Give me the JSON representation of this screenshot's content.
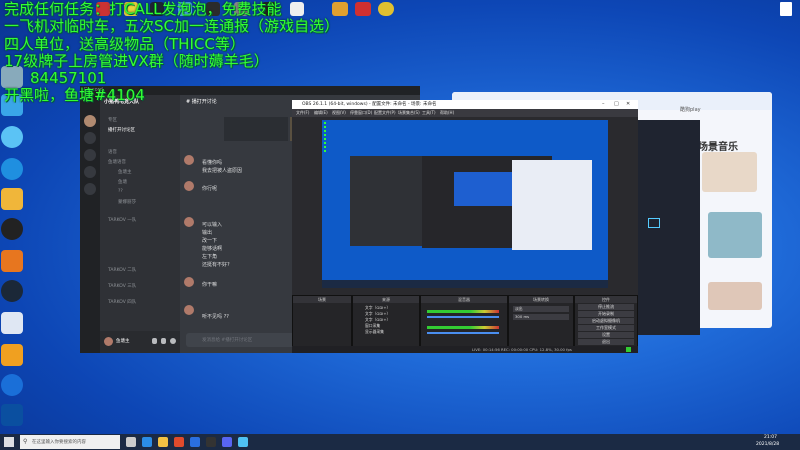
{
  "overlay": {
    "line1": "完成任何任务：打CALL发泡泡，免费技能",
    "line2": "一飞机对临时车，五次SC加一连通报（游戏自选）",
    "line3": "四人单位，送高级物品（THICC等）",
    "line4": "17级牌子上房管进VX群（随时薅羊毛）",
    "line5": "84457101",
    "line6": "开黑啦，鱼塘#4104"
  },
  "desktop_icons": [
    {
      "name": "recycle-bin-icon",
      "label": ""
    },
    {
      "name": "computer-icon",
      "label": ""
    },
    {
      "name": "cloud-icon",
      "label": ""
    },
    {
      "name": "ie-icon",
      "label": ""
    },
    {
      "name": "app-icon",
      "label": ""
    },
    {
      "name": "qq-icon",
      "label": ""
    },
    {
      "name": "app-icon",
      "label": ""
    },
    {
      "name": "steam-icon",
      "label": ""
    },
    {
      "name": "chat-icon",
      "label": ""
    },
    {
      "name": "help-icon",
      "label": ""
    },
    {
      "name": "k-icon",
      "label": ""
    },
    {
      "name": "settings-icon",
      "label": ""
    }
  ],
  "discord": {
    "title": "Discord",
    "server_name": "小猪鸭电竞大队",
    "channels": [
      {
        "label": "专区"
      },
      {
        "label": "专区"
      },
      {
        "label": "播打开讨论区"
      },
      {
        "label": "语音"
      },
      {
        "label": "鱼塘语音"
      },
      {
        "label": "TARKOV 一队"
      },
      {
        "label": "TARKOV 二队"
      },
      {
        "label": "TARKOV 三队"
      },
      {
        "label": "TARKOV 四队"
      }
    ],
    "voice_members": [
      "鱼塘主",
      "鱼塘",
      "??",
      "蒙娜丽莎"
    ],
    "chat_header": "# 播打开讨论",
    "messages": [
      "看懂你吗",
      "我去把被人盗原因",
      "你行呢",
      "可以输入",
      "输出",
      "改一下",
      "能够话啊",
      "左下角",
      "还挺有不好?",
      "你干嘛",
      "听不见吗 ??"
    ],
    "input_placeholder": "发消息给 #播打开讨论区",
    "user_name": "鱼塘主"
  },
  "obs": {
    "title": "OBS 26.1.1 (64-bit, windows) - 配置文件: 未命名 - 场景: 未命名",
    "menu": [
      "文件(F)",
      "编辑(E)",
      "视图(V)",
      "停靠窗口(D)",
      "配置文件(P)",
      "场景集合(S)",
      "工具(T)",
      "帮助(H)"
    ],
    "docks": [
      "场景",
      "来源",
      "混音器",
      "场景转换",
      "控件"
    ],
    "sources": [
      "文字（GDI+）",
      "文字（GDI+）",
      "文字（GDI+）",
      "窗口采集",
      "显示器采集"
    ],
    "controls": [
      "停止推流",
      "开始录制",
      "启动虚拟摄像机",
      "工作室模式",
      "设置",
      "退出"
    ],
    "transition": "淡出",
    "duration": "300 ms",
    "status": "LIVE: 00:14:56   REC: 00:00:00   CPU: 12.8%, 30.00 fps"
  },
  "music": {
    "heading": "场景音乐",
    "sub1": "酷狗play"
  },
  "taskbar": {
    "search_placeholder": "在这里输入你要搜索的内容",
    "time": "21:07",
    "date": "2021/8/28"
  },
  "colors": {
    "overlay_green": "#33ff33",
    "discord_bg": "#36393f",
    "obs_bg": "#2a2a2e",
    "desktop_blue": "#1f6ad8"
  }
}
